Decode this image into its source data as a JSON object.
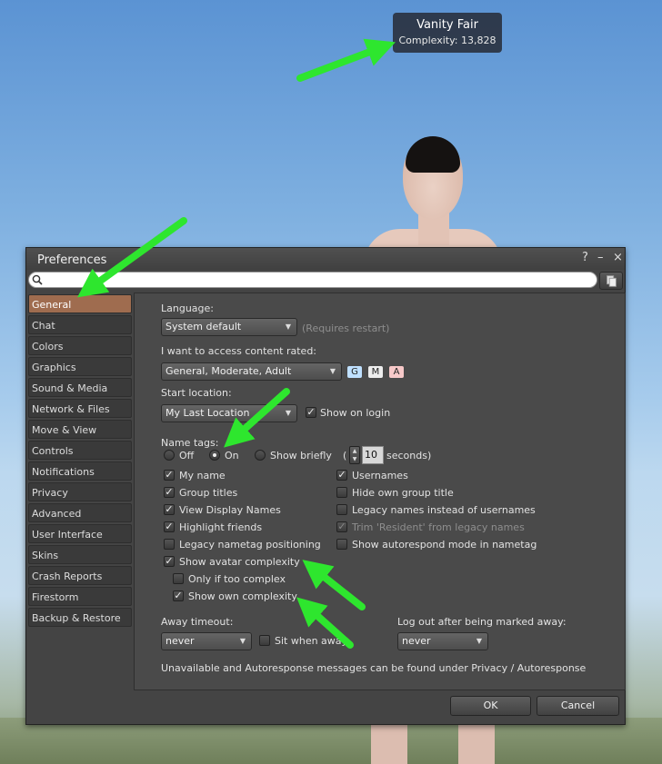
{
  "scene": {
    "nametag": {
      "name": "Vanity Fair",
      "complexity": "Complexity: 13,828"
    }
  },
  "colors": {
    "active_tab": "#9f6c4f",
    "arrow": "#2ee62e",
    "badge_g": "#bfe0ff",
    "badge_m": "#ededed",
    "badge_a": "#f7c9c9"
  },
  "window": {
    "title": "Preferences",
    "help_label": "?",
    "minimize_label": "–",
    "close_label": "×",
    "search": {
      "value": "",
      "placeholder": ""
    }
  },
  "sidebar": {
    "items": [
      {
        "label": "General",
        "active": true
      },
      {
        "label": "Chat"
      },
      {
        "label": "Colors"
      },
      {
        "label": "Graphics"
      },
      {
        "label": "Sound & Media"
      },
      {
        "label": "Network & Files"
      },
      {
        "label": "Move & View"
      },
      {
        "label": "Controls"
      },
      {
        "label": "Notifications"
      },
      {
        "label": "Privacy"
      },
      {
        "label": "Advanced"
      },
      {
        "label": "User Interface"
      },
      {
        "label": "Skins"
      },
      {
        "label": "Crash Reports"
      },
      {
        "label": "Firestorm"
      },
      {
        "label": "Backup & Restore"
      }
    ]
  },
  "general": {
    "language_label": "Language:",
    "language_value": "System default",
    "language_note": "(Requires restart)",
    "content_label": "I want to access content rated:",
    "content_value": "General, Moderate, Adult",
    "rating_g": "G",
    "rating_m": "M",
    "rating_a": "A",
    "start_location_label": "Start location:",
    "start_location_value": "My Last Location",
    "show_on_login": {
      "label": "Show on login",
      "checked": true
    },
    "name_tags_label": "Name tags:",
    "name_tags_options": {
      "off": "Off",
      "on": "On",
      "briefly": "Show briefly"
    },
    "name_tags_selected": "On",
    "paren_open": "(",
    "seconds_value": "10",
    "seconds_label": "seconds)",
    "left_checks": [
      {
        "label": "My name",
        "checked": true
      },
      {
        "label": "Group titles",
        "checked": true
      },
      {
        "label": "View Display Names",
        "checked": true
      },
      {
        "label": "Highlight friends",
        "checked": true
      },
      {
        "label": "Legacy nametag positioning",
        "checked": false
      },
      {
        "label": "Show avatar complexity",
        "checked": true
      },
      {
        "label": "Only if too complex",
        "checked": false
      },
      {
        "label": "Show own complexity",
        "checked": true
      }
    ],
    "right_checks": [
      {
        "label": "Usernames",
        "checked": true
      },
      {
        "label": "Hide own group title",
        "checked": false
      },
      {
        "label": "Legacy names instead of usernames",
        "checked": false
      },
      {
        "label": "Trim 'Resident' from legacy names",
        "checked": true,
        "disabled": true
      },
      {
        "label": "Show autorespond mode in nametag",
        "checked": false
      }
    ],
    "away_timeout_label": "Away timeout:",
    "away_timeout_value": "never",
    "sit_when_away": {
      "label": "Sit when away",
      "checked": false
    },
    "logout_label": "Log out after being marked away:",
    "logout_value": "never",
    "footer_note": "Unavailable and Autoresponse messages can be found under Privacy / Autoresponse"
  },
  "buttons": {
    "ok": "OK",
    "cancel": "Cancel"
  }
}
